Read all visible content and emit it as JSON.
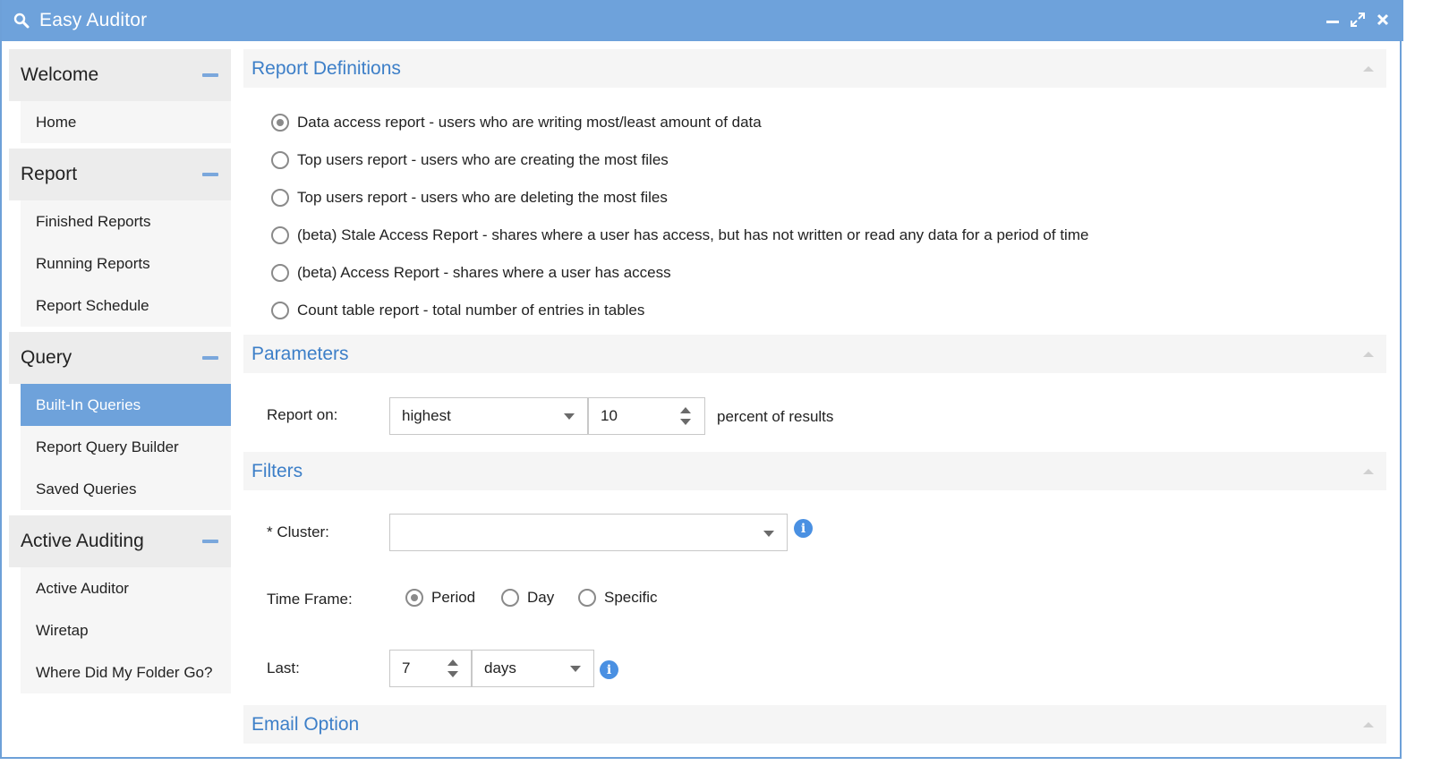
{
  "window": {
    "title": "Easy Auditor",
    "icon": "search-icon",
    "controls": [
      "minimize-icon",
      "maximize-icon",
      "close-icon"
    ],
    "accent_color": "#6ea2db"
  },
  "sidebar": {
    "groups": [
      {
        "title": "Welcome",
        "items": [
          {
            "label": "Home"
          }
        ]
      },
      {
        "title": "Report",
        "items": [
          {
            "label": "Finished Reports"
          },
          {
            "label": "Running Reports"
          },
          {
            "label": "Report Schedule"
          }
        ]
      },
      {
        "title": "Query",
        "items": [
          {
            "label": "Built-In Queries",
            "active": true
          },
          {
            "label": "Report Query Builder"
          },
          {
            "label": "Saved Queries"
          }
        ]
      },
      {
        "title": "Active Auditing",
        "items": [
          {
            "label": "Active Auditor"
          },
          {
            "label": "Wiretap"
          },
          {
            "label": "Where Did My Folder Go?"
          }
        ]
      }
    ]
  },
  "main": {
    "report_definitions": {
      "title": "Report Definitions",
      "options": [
        {
          "label": "Data access report - users who are writing most/least amount of data",
          "checked": true
        },
        {
          "label": "Top users report - users who are creating the most files",
          "checked": false
        },
        {
          "label": "Top users report - users who are deleting the most files",
          "checked": false
        },
        {
          "label": "(beta) Stale Access Report - shares where a user has access, but has not written or read any data for a period of time",
          "checked": false
        },
        {
          "label": "(beta) Access Report - shares where a user has access",
          "checked": false
        },
        {
          "label": "Count table report - total number of entries in tables",
          "checked": false
        }
      ]
    },
    "parameters": {
      "title": "Parameters",
      "report_on_label": "Report on:",
      "report_on_value": "highest",
      "percent_value": "10",
      "percent_suffix": "percent of results"
    },
    "filters": {
      "title": "Filters",
      "cluster_label": "* Cluster:",
      "cluster_value": "",
      "time_frame_label": "Time Frame:",
      "time_frame_options": [
        {
          "label": "Period",
          "checked": true
        },
        {
          "label": "Day",
          "checked": false
        },
        {
          "label": "Specific",
          "checked": false
        }
      ],
      "last_label": "Last:",
      "last_value": "7",
      "last_unit": "days",
      "info_glyph": "i"
    },
    "email_option": {
      "title": "Email Option"
    }
  }
}
